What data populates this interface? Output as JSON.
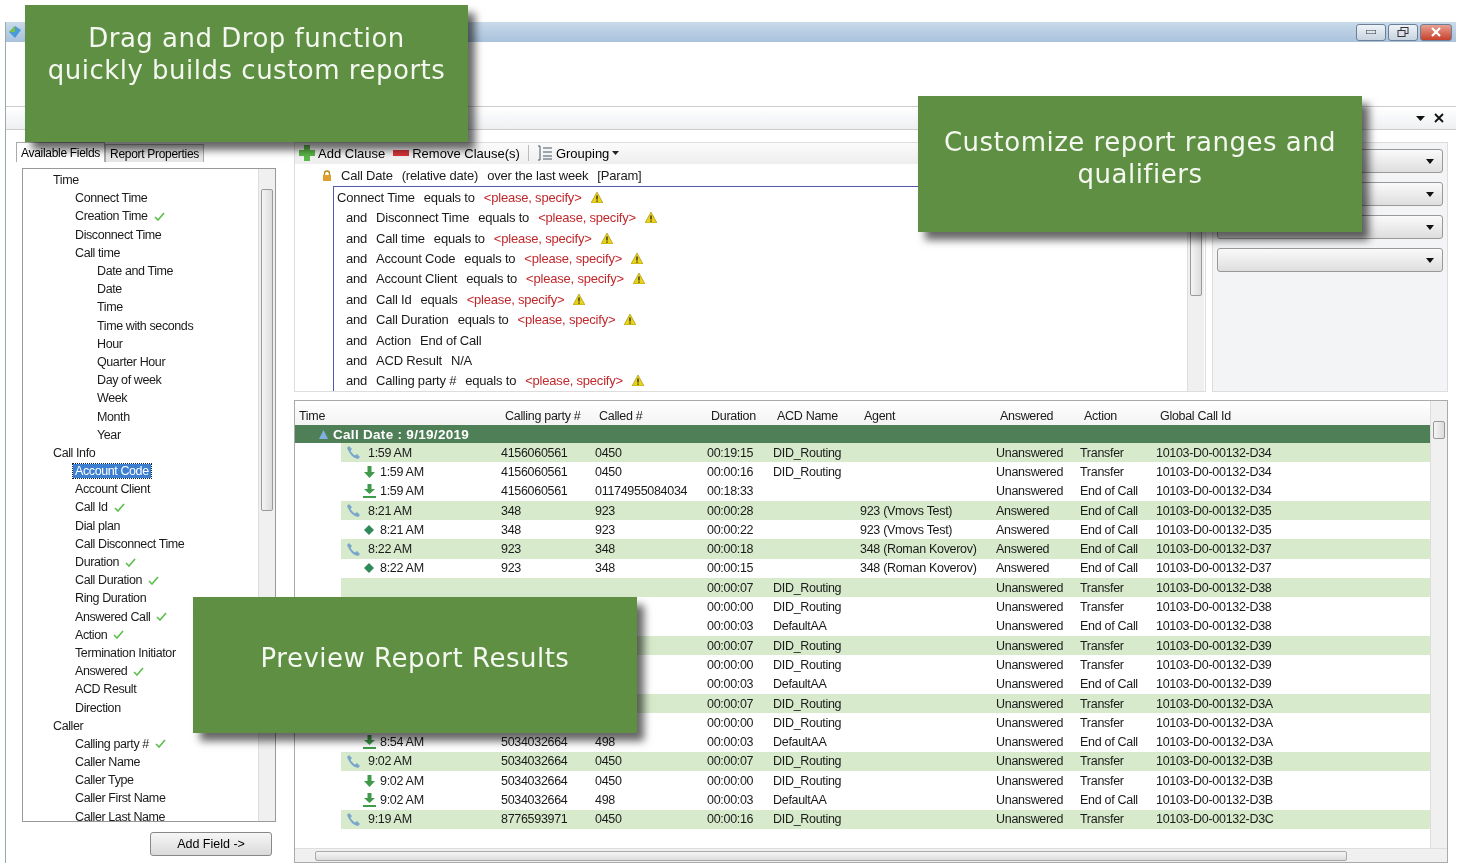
{
  "callouts": [
    {
      "text": "Drag and Drop function quickly builds custom reports"
    },
    {
      "text": "Customize report ranges and qualifiers"
    },
    {
      "text": "Preview Report Results"
    }
  ],
  "left_panel": {
    "tabs": [
      {
        "label": "Available Fields",
        "selected": true
      },
      {
        "label": "Report Properties",
        "selected": false
      }
    ],
    "tree": [
      {
        "label": "Time",
        "checked": false,
        "selected": false,
        "children": [
          {
            "label": "Connect Time",
            "checked": false,
            "selected": false
          },
          {
            "label": "Creation Time",
            "checked": true,
            "selected": false
          },
          {
            "label": "Disconnect Time",
            "checked": false,
            "selected": false
          },
          {
            "label": "Call time",
            "checked": false,
            "selected": false,
            "children": [
              {
                "label": "Date and Time",
                "checked": false,
                "selected": false
              },
              {
                "label": "Date",
                "checked": false,
                "selected": false
              },
              {
                "label": "Time",
                "checked": false,
                "selected": false
              },
              {
                "label": "Time with seconds",
                "checked": false,
                "selected": false
              },
              {
                "label": "Hour",
                "checked": false,
                "selected": false
              },
              {
                "label": "Quarter Hour",
                "checked": false,
                "selected": false
              },
              {
                "label": "Day of week",
                "checked": false,
                "selected": false
              },
              {
                "label": "Week",
                "checked": false,
                "selected": false
              },
              {
                "label": "Month",
                "checked": false,
                "selected": false
              },
              {
                "label": "Year",
                "checked": false,
                "selected": false
              }
            ]
          }
        ]
      },
      {
        "label": "Call Info",
        "checked": false,
        "selected": false,
        "children": [
          {
            "label": "Account Code",
            "checked": false,
            "selected": true
          },
          {
            "label": "Account Client",
            "checked": false,
            "selected": false
          },
          {
            "label": "Call Id",
            "checked": true,
            "selected": false
          },
          {
            "label": "Dial plan",
            "checked": false,
            "selected": false
          },
          {
            "label": "Call Disconnect Time",
            "checked": false,
            "selected": false
          },
          {
            "label": "Duration",
            "checked": true,
            "selected": false
          },
          {
            "label": "Call Duration",
            "checked": true,
            "selected": false
          },
          {
            "label": "Ring Duration",
            "checked": false,
            "selected": false
          },
          {
            "label": "Answered Call",
            "checked": true,
            "selected": false
          },
          {
            "label": "Action",
            "checked": true,
            "selected": false
          },
          {
            "label": "Termination Initiator",
            "checked": false,
            "selected": false
          },
          {
            "label": "Answered",
            "checked": true,
            "selected": false
          },
          {
            "label": "ACD Result",
            "checked": false,
            "selected": false
          },
          {
            "label": "Direction",
            "checked": false,
            "selected": false
          }
        ]
      },
      {
        "label": "Caller",
        "checked": false,
        "selected": false,
        "children": [
          {
            "label": "Calling party #",
            "checked": true,
            "selected": false
          },
          {
            "label": "Caller Name",
            "checked": false,
            "selected": false
          },
          {
            "label": "Caller Type",
            "checked": false,
            "selected": false
          },
          {
            "label": "Caller First Name",
            "checked": false,
            "selected": false
          },
          {
            "label": "Caller Last Name",
            "checked": false,
            "selected": false
          }
        ]
      }
    ],
    "add_button": "Add Field ->"
  },
  "conditions": {
    "toolbar": [
      "Add Clause",
      "Remove Clause(s)",
      "Grouping"
    ],
    "clauses": [
      {
        "kind": "locked",
        "field": "Call Date",
        "qualifier": "(relative date)",
        "operator": "over the last week",
        "value": "[Param]",
        "warning": false
      },
      {
        "kind": "condition",
        "field": "Connect Time",
        "operator": "equals to",
        "value": "<please, specify>",
        "warning": true
      },
      {
        "kind": "condition",
        "connector": "and",
        "field": "Disconnect Time",
        "operator": "equals to",
        "value": "<please, specify>",
        "warning": true
      },
      {
        "kind": "condition",
        "connector": "and",
        "field": "Call time",
        "operator": "equals to",
        "value": "<please, specify>",
        "warning": true
      },
      {
        "kind": "condition",
        "connector": "and",
        "field": "Account Code",
        "operator": "equals to",
        "value": "<please, specify>",
        "warning": true
      },
      {
        "kind": "condition",
        "connector": "and",
        "field": "Account Client",
        "operator": "equals to",
        "value": "<please, specify>",
        "warning": true
      },
      {
        "kind": "condition",
        "connector": "and",
        "field": "Call Id",
        "operator": "equals",
        "value": "<please, specify>",
        "warning": true
      },
      {
        "kind": "condition",
        "connector": "and",
        "field": "Call Duration",
        "operator": "equals to",
        "value": "<please, specify>",
        "warning": true
      },
      {
        "kind": "condition",
        "connector": "and",
        "field": "Action",
        "value": "End of Call",
        "warning": false
      },
      {
        "kind": "condition",
        "connector": "and",
        "field": "ACD Result",
        "value": "N/A",
        "warning": false
      },
      {
        "kind": "condition",
        "connector": "and",
        "field": "Calling party #",
        "operator": "equals to",
        "value": "<please, specify>",
        "warning": true
      }
    ]
  },
  "results": {
    "columns": [
      "Time",
      "Calling party #",
      "Called #",
      "Duration",
      "ACD Name",
      "Agent",
      "Answered",
      "Action",
      "Global Call Id"
    ],
    "group": "Call Date : 9/19/2019",
    "rows": [
      {
        "kind": "call",
        "time": "1:59 AM",
        "calling": "4156060561",
        "called": "0450",
        "duration": "00:19:15",
        "acd": "DID_Routing",
        "answered": "Unanswered",
        "action": "Transfer",
        "gcid": "10103-D0-00132-D34"
      },
      {
        "kind": "arrow",
        "time": "1:59 AM",
        "calling": "4156060561",
        "called": "0450",
        "duration": "00:00:16",
        "acd": "DID_Routing",
        "answered": "Unanswered",
        "action": "Transfer",
        "gcid": "10103-D0-00132-D34"
      },
      {
        "kind": "download",
        "time": "1:59 AM",
        "calling": "4156060561",
        "called": "01174955084034",
        "duration": "00:18:33",
        "answered": "Unanswered",
        "action": "End of Call",
        "gcid": "10103-D0-00132-D34"
      },
      {
        "kind": "call",
        "time": "8:21 AM",
        "calling": "348",
        "called": "923",
        "duration": "00:00:28",
        "agent": "923 (Vmovs Test)",
        "answered": "Answered",
        "action": "End of Call",
        "gcid": "10103-D0-00132-D35"
      },
      {
        "kind": "diamond",
        "time": "8:21 AM",
        "calling": "348",
        "called": "923",
        "duration": "00:00:22",
        "agent": "923 (Vmovs Test)",
        "answered": "Answered",
        "action": "End of Call",
        "gcid": "10103-D0-00132-D35"
      },
      {
        "kind": "call",
        "time": "8:22 AM",
        "calling": "923",
        "called": "348",
        "duration": "00:00:18",
        "agent": "348 (Roman Koverov)",
        "answered": "Answered",
        "action": "End of Call",
        "gcid": "10103-D0-00132-D37"
      },
      {
        "kind": "diamond",
        "time": "8:22 AM",
        "calling": "923",
        "called": "348",
        "duration": "00:00:15",
        "agent": "348 (Roman Koverov)",
        "answered": "Answered",
        "action": "End of Call",
        "gcid": "10103-D0-00132-D37"
      },
      {
        "kind": "call",
        "duration": "00:00:07",
        "acd": "DID_Routing",
        "answered": "Unanswered",
        "action": "Transfer",
        "gcid": "10103-D0-00132-D38"
      },
      {
        "kind": "arrow",
        "duration": "00:00:00",
        "acd": "DID_Routing",
        "answered": "Unanswered",
        "action": "Transfer",
        "gcid": "10103-D0-00132-D38"
      },
      {
        "kind": "download",
        "duration": "00:00:03",
        "acd": "DefaultAA",
        "answered": "Unanswered",
        "action": "End of Call",
        "gcid": "10103-D0-00132-D38"
      },
      {
        "kind": "call",
        "duration": "00:00:07",
        "acd": "DID_Routing",
        "answered": "Unanswered",
        "action": "Transfer",
        "gcid": "10103-D0-00132-D39"
      },
      {
        "kind": "arrow",
        "duration": "00:00:00",
        "acd": "DID_Routing",
        "answered": "Unanswered",
        "action": "Transfer",
        "gcid": "10103-D0-00132-D39"
      },
      {
        "kind": "download",
        "duration": "00:00:03",
        "acd": "DefaultAA",
        "answered": "Unanswered",
        "action": "End of Call",
        "gcid": "10103-D0-00132-D39"
      },
      {
        "kind": "call",
        "duration": "00:00:07",
        "acd": "DID_Routing",
        "answered": "Unanswered",
        "action": "Transfer",
        "gcid": "10103-D0-00132-D3A"
      },
      {
        "kind": "arrow",
        "duration": "00:00:00",
        "acd": "DID_Routing",
        "answered": "Unanswered",
        "action": "Transfer",
        "gcid": "10103-D0-00132-D3A"
      },
      {
        "kind": "download",
        "time": "8:54 AM",
        "calling": "5034032664",
        "called": "498",
        "duration": "00:00:03",
        "acd": "DefaultAA",
        "answered": "Unanswered",
        "action": "End of Call",
        "gcid": "10103-D0-00132-D3A"
      },
      {
        "kind": "call",
        "time": "9:02 AM",
        "calling": "5034032664",
        "called": "0450",
        "duration": "00:00:07",
        "acd": "DID_Routing",
        "answered": "Unanswered",
        "action": "Transfer",
        "gcid": "10103-D0-00132-D3B"
      },
      {
        "kind": "arrow",
        "time": "9:02 AM",
        "calling": "5034032664",
        "called": "0450",
        "duration": "00:00:00",
        "acd": "DID_Routing",
        "answered": "Unanswered",
        "action": "Transfer",
        "gcid": "10103-D0-00132-D3B"
      },
      {
        "kind": "download",
        "time": "9:02 AM",
        "calling": "5034032664",
        "called": "498",
        "duration": "00:00:03",
        "acd": "DefaultAA",
        "answered": "Unanswered",
        "action": "End of Call",
        "gcid": "10103-D0-00132-D3B"
      },
      {
        "kind": "call",
        "time": "9:19 AM",
        "calling": "8776593971",
        "called": "0450",
        "duration": "00:00:16",
        "acd": "DID_Routing",
        "answered": "Unanswered",
        "action": "Transfer",
        "gcid": "10103-D0-00132-D3C"
      }
    ]
  }
}
